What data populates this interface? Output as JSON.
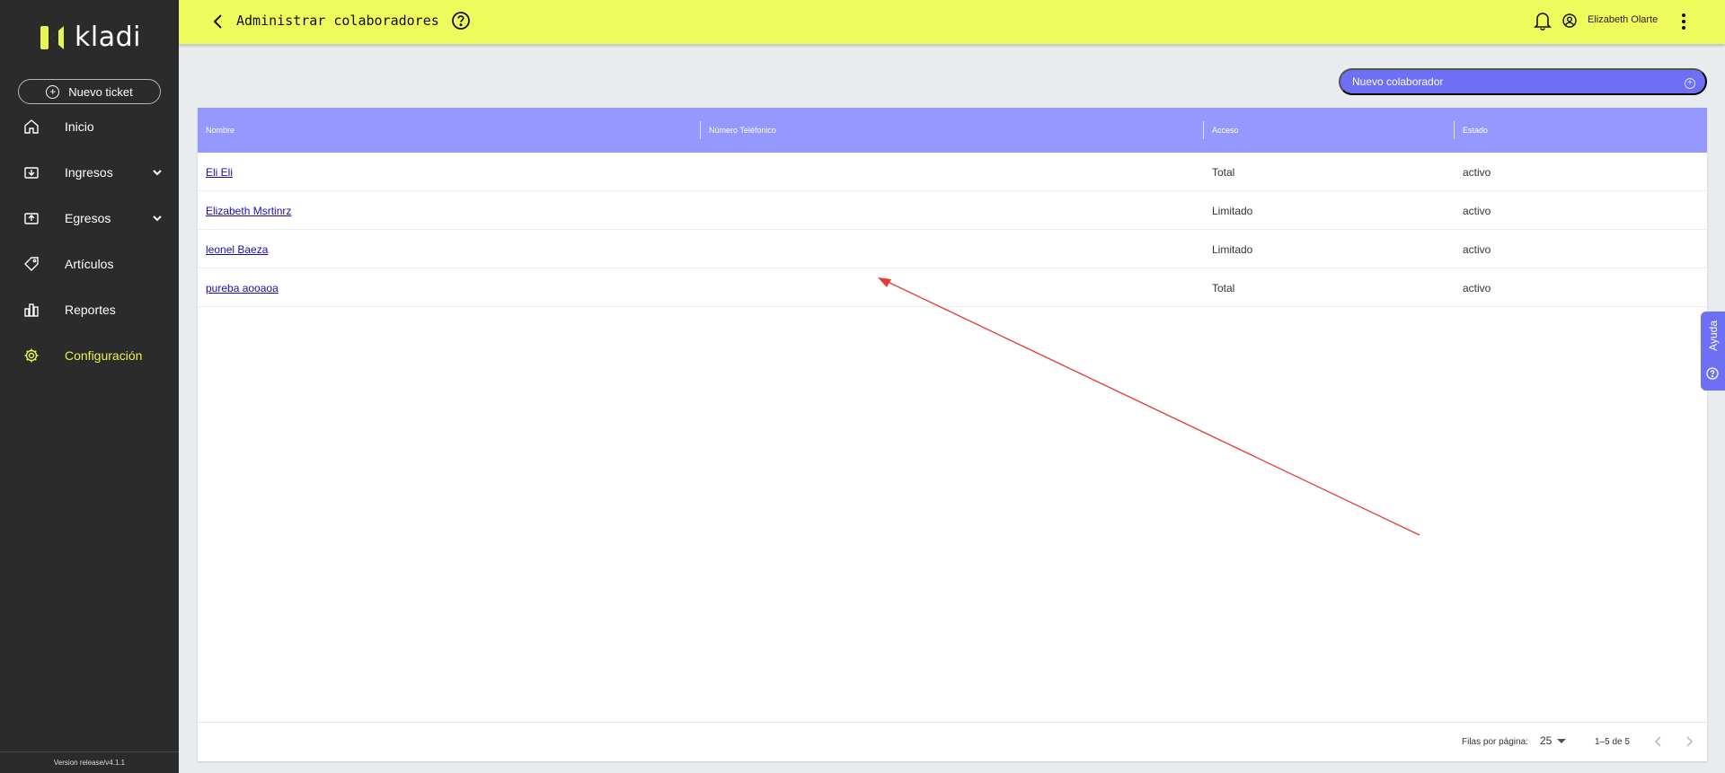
{
  "sidebar": {
    "logo_text": "kladi",
    "new_ticket_label": "Nuevo ticket",
    "items": [
      {
        "label": "Inicio",
        "icon": "home-icon"
      },
      {
        "label": "Ingresos",
        "icon": "income-icon"
      },
      {
        "label": "Egresos",
        "icon": "expense-icon"
      },
      {
        "label": "Artículos",
        "icon": "tag-icon"
      },
      {
        "label": "Reportes",
        "icon": "chart-icon"
      },
      {
        "label": "Configuración",
        "icon": "gear-icon"
      }
    ],
    "version": "Version release/v4.1.1"
  },
  "header": {
    "title": "Administrar colaboradores",
    "user_name": "Elizabeth Olarte"
  },
  "actions": {
    "new_collaborator_label": "Nuevo colaborador"
  },
  "table": {
    "columns": [
      "Nombre",
      "Número Teléfonico",
      "Acceso",
      "Estado"
    ],
    "rows": [
      {
        "nombre": "Eli Eli",
        "telefono": "",
        "acceso": "Total",
        "estado": "activo"
      },
      {
        "nombre": "Elizabeth Msrtinrz",
        "telefono": "",
        "acceso": "Limitado",
        "estado": "activo"
      },
      {
        "nombre": "leonel Baeza",
        "telefono": "",
        "acceso": "Limitado",
        "estado": "activo"
      },
      {
        "nombre": "pureba aooaoa",
        "telefono": "",
        "acceso": "Total",
        "estado": "activo"
      }
    ],
    "footer": {
      "rows_per_page_label": "Filas por página:",
      "rows_per_page_value": "25",
      "range": "1–5 de 5"
    }
  },
  "help_tab": {
    "label": "Ayuda"
  },
  "colors": {
    "sidebar_bg": "#2b2b2b",
    "topbar_bg": "#eefb5c",
    "accent": "#6d6ff5",
    "table_header_bg": "#9599ff",
    "active_nav": "#e8f456",
    "annotation_arrow": "#e53935"
  }
}
